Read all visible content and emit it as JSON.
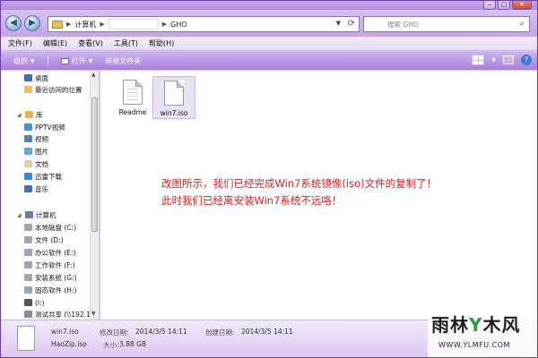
{
  "window": {
    "buttons": {
      "minimize": "–",
      "maximize": "□",
      "close": "✕"
    }
  },
  "address": {
    "crumbs": [
      "计算机",
      "GHO"
    ],
    "search_placeholder": "搜索 GHO"
  },
  "menu": [
    "文件(F)",
    "编辑(E)",
    "查看(V)",
    "工具(T)",
    "帮助(H)"
  ],
  "toolbar": {
    "organize": "组织",
    "open": "打开",
    "new_folder": "新建文件夹"
  },
  "nav": {
    "favorites": [
      "桌面",
      "最近访问的位置"
    ],
    "library_header": "库",
    "libraries": [
      "PPTV视频",
      "视频",
      "图片",
      "文档",
      "迅雷下载",
      "音乐"
    ],
    "computer_header": "计算机",
    "drives": [
      "本地磁盘 (C:)",
      "文件 (D:)",
      "办公软件 (E:)",
      "工作软件 (F:)",
      "安装系统 (G:)",
      "固态软件 (H:)",
      "(I:)",
      "测试共享 (\\\\192.1"
    ]
  },
  "files": [
    {
      "name": "Readme",
      "selected": false
    },
    {
      "name": "win7.iso",
      "selected": true
    }
  ],
  "note": {
    "line1": "改图所示，我们已经完成Win7系统镜像(iso)文件的复制了！",
    "line2": "此时我们已经离安装Win7系统不远咯！"
  },
  "details": {
    "file_name": "win7.iso",
    "modified_label": "修改日期:",
    "modified_value": "2014/3/5 14:11",
    "created_label": "创建日期:",
    "created_value": "2014/3/5 14:11",
    "app": "HaoZip.iso",
    "size_label": "大小:",
    "size_value": "3.88 GB"
  },
  "watermark": {
    "title_a": "雨林",
    "title_y": "Y",
    "title_b": "木风",
    "url": "WWW.YLMFU.COM"
  },
  "colors": {
    "toolbar": "#a97fdb",
    "note_text": "#d42020",
    "watermark_green": "#2e9d3a"
  }
}
